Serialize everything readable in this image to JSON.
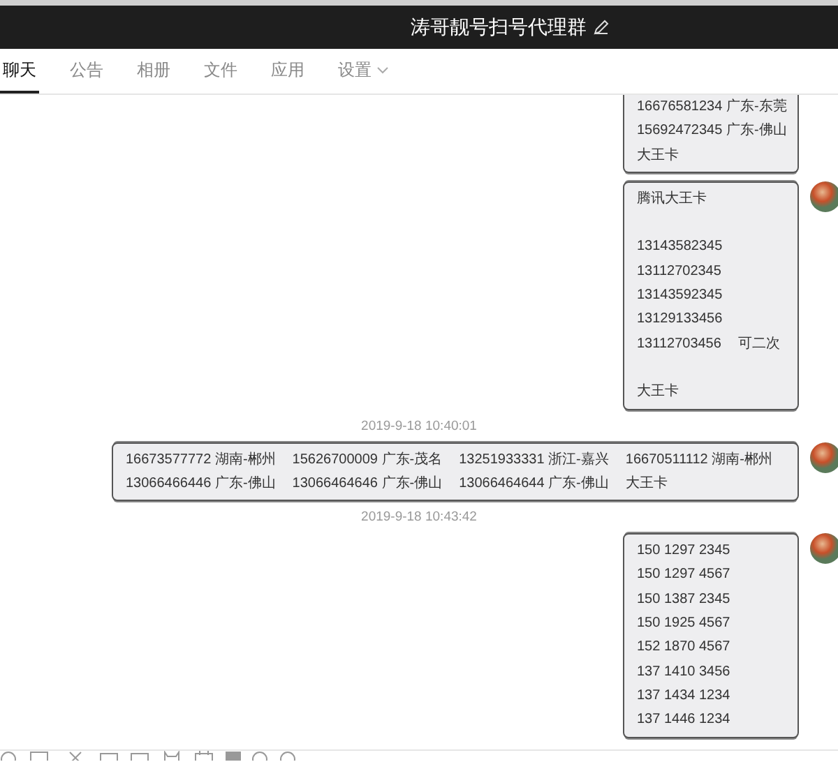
{
  "window": {
    "title": "涛哥靓号扫号代理群"
  },
  "tabs": [
    {
      "label": "聊天",
      "selected": true
    },
    {
      "label": "公告",
      "selected": false
    },
    {
      "label": "相册",
      "selected": false
    },
    {
      "label": "文件",
      "selected": false
    },
    {
      "label": "应用",
      "selected": false
    },
    {
      "label": "设置",
      "selected": false,
      "dropdown": true
    }
  ],
  "chat": [
    {
      "kind": "message",
      "cut_top": true,
      "lines": [
        {
          "parts": [
            "16676581234 广东-东莞"
          ]
        },
        {
          "parts": [
            "15692472345 广东-佛山"
          ]
        },
        {
          "parts": [
            "大王卡"
          ]
        }
      ]
    },
    {
      "kind": "message",
      "cut_top": false,
      "lines": [
        {
          "parts": [
            "腾讯大王卡"
          ]
        },
        {
          "parts": [
            "13143582345"
          ],
          "space_before": true
        },
        {
          "parts": [
            "13112702345"
          ]
        },
        {
          "parts": [
            "13143592345"
          ]
        },
        {
          "parts": [
            "13129133456"
          ]
        },
        {
          "parts": [
            "13112703456",
            "可二次"
          ]
        },
        {
          "parts": [
            "大王卡"
          ],
          "space_before": true
        }
      ]
    },
    {
      "kind": "time",
      "text": "2019-9-18 10:40:01"
    },
    {
      "kind": "message",
      "cut_top": false,
      "lines": [
        {
          "parts": [
            "16673577772 湖南-郴州",
            "15626700009 广东-茂名",
            "13251933331 浙江-嘉兴",
            "16670511112 湖南-郴州"
          ]
        },
        {
          "parts": [
            "13066466446 广东-佛山",
            "13066464646 广东-佛山",
            "13066464644 广东-佛山",
            "大王卡"
          ]
        }
      ]
    },
    {
      "kind": "time",
      "text": "2019-9-18 10:43:42"
    },
    {
      "kind": "message",
      "cut_top": false,
      "lines": [
        {
          "parts": [
            "150 1297 2345"
          ]
        },
        {
          "parts": [
            "150 1297 4567"
          ]
        },
        {
          "parts": [
            "150 1387 2345"
          ]
        },
        {
          "parts": [
            "150 1925 4567"
          ]
        },
        {
          "parts": [
            "152 1870 4567"
          ]
        },
        {
          "parts": [
            "137 1410 3456"
          ]
        },
        {
          "parts": [
            "137 1434 1234"
          ]
        },
        {
          "parts": [
            "137 1446 1234"
          ]
        }
      ]
    }
  ]
}
